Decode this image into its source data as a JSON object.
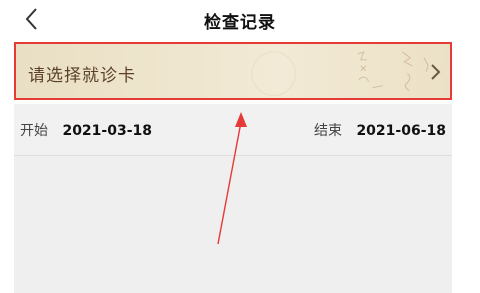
{
  "header": {
    "title": "检查记录",
    "back_icon": "back-chevron-icon"
  },
  "card": {
    "label": "请选择就诊卡",
    "chevron_icon": "chevron-right-icon",
    "decoration": "calligraphy-watermark"
  },
  "dates": {
    "start_label": "开始",
    "start_value": "2021-03-18",
    "end_label": "结束",
    "end_value": "2021-06-18"
  },
  "colors": {
    "highlight_border": "#e53a35",
    "arrow": "#e53a35",
    "card_text": "#5a4128"
  }
}
